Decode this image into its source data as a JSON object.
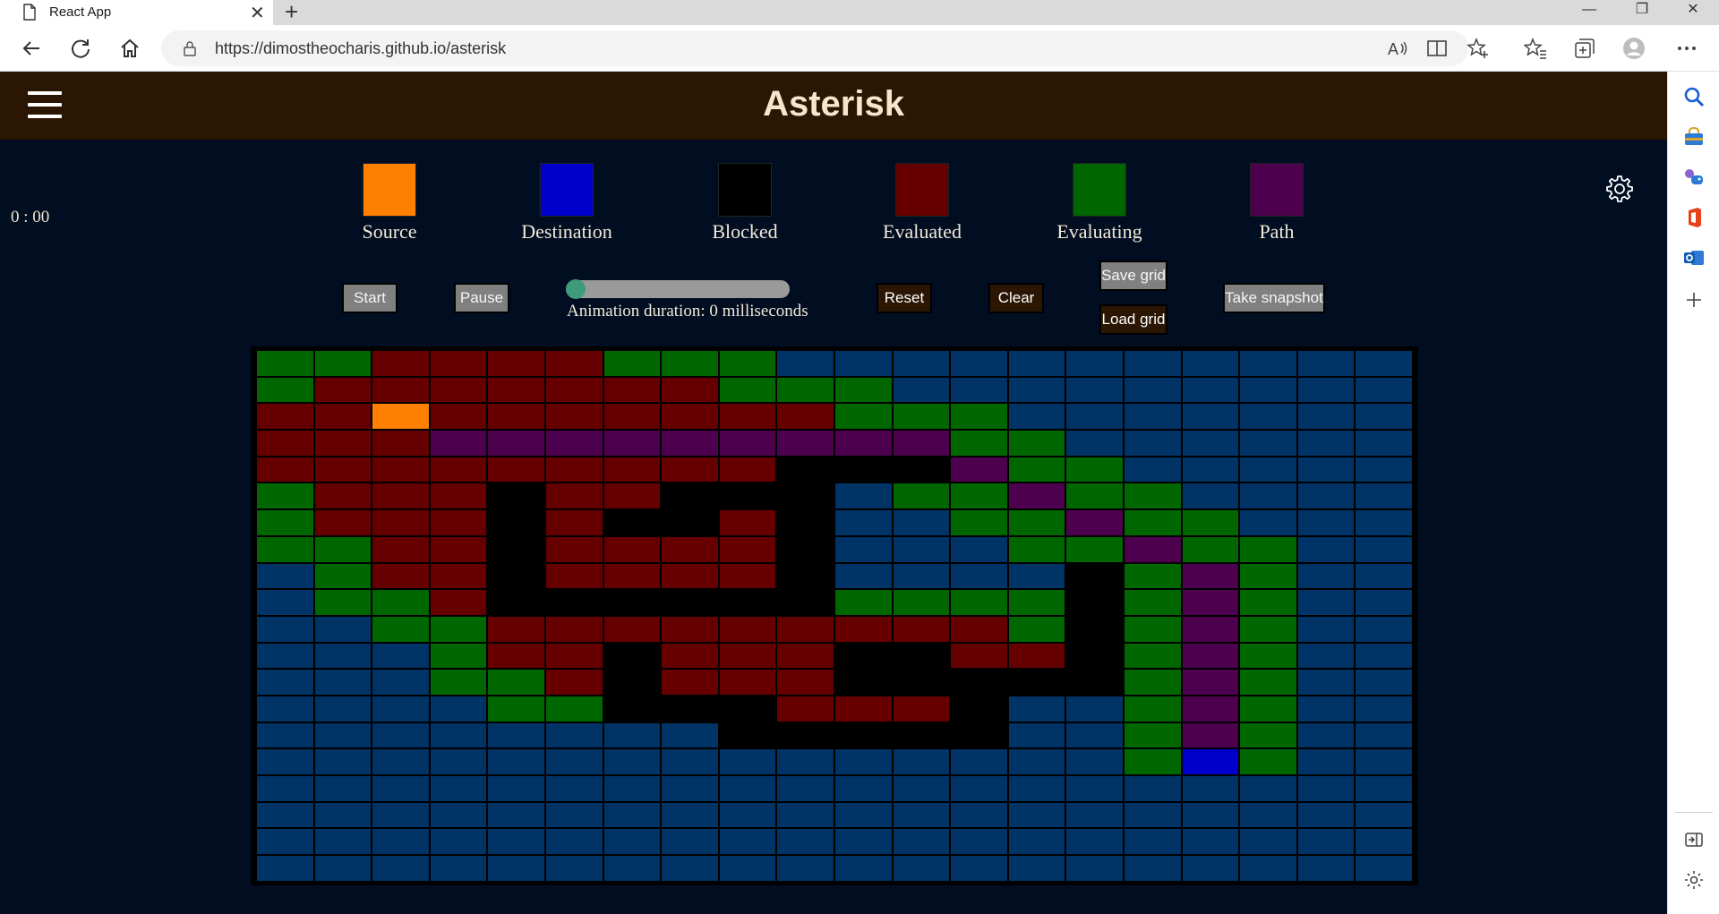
{
  "browser": {
    "tab_title": "React App",
    "url": "https://dimostheocharis.github.io/asterisk"
  },
  "app": {
    "title": "Asterisk",
    "timer": "0 : 00"
  },
  "legend": [
    {
      "label": "Source",
      "color": "#ff8000"
    },
    {
      "label": "Destination",
      "color": "#0000cd"
    },
    {
      "label": "Blocked",
      "color": "#000000"
    },
    {
      "label": "Evaluated",
      "color": "#660000"
    },
    {
      "label": "Evaluating",
      "color": "#006600"
    },
    {
      "label": "Path",
      "color": "#4d004d"
    }
  ],
  "controls": {
    "start": "Start",
    "pause": "Pause",
    "animation_label": "Animation duration: 0 milliseconds",
    "animation_duration": 0,
    "reset": "Reset",
    "clear": "Clear",
    "save_grid": "Save grid",
    "load_grid": "Load grid",
    "snapshot": "Take snapshot"
  },
  "grid": {
    "rows": 20,
    "cols": 20,
    "color_key": {
      "U": "#003366",
      "G": "#006600",
      "R": "#660000",
      "P": "#4d004d",
      "K": "#000000",
      "S": "#ff8000",
      "D": "#0000cd"
    },
    "cells": [
      "GGRRRRGGGUUUUUUUUUUU",
      "GRRRRRRRGGGUUUUUUUUU",
      "RRSRRRRRRRGGGUUUUUUU",
      "RRRPPPPPPPPPGGUUUUUU",
      "RRRRRRRRRKKKPGGUUUUU",
      "GRRRKRRKKKUGGPGGUUUU",
      "GRRRKRKKRKUUGGPGGUUU",
      "GGRRKRRRRKUUUGGPGGUU",
      "UGRRKRRRRKUUUUKGPGUU",
      "UGGRKKKKKKGGGGKGPGUU",
      "UUGGRRRRRRRRRGKGPGUU",
      "UUUGRRKRRRKKRRKGPGUU",
      "UUUGGRKRRRKKKKKGPGUU",
      "UUUUGGKKKRRRKUUGPGUU",
      "UUUUUUUUKKKKKUUGPGUU",
      "UUUUUUUUUUUUUUUGDGUU",
      "UUUUUUUUUUUUUUUUUUUU",
      "UUUUUUUUUUUUUUUUUUUU",
      "UUUUUUUUUUUUUUUUUUUU",
      "UUUUUUUUUUUUUUUUUUUU"
    ]
  }
}
